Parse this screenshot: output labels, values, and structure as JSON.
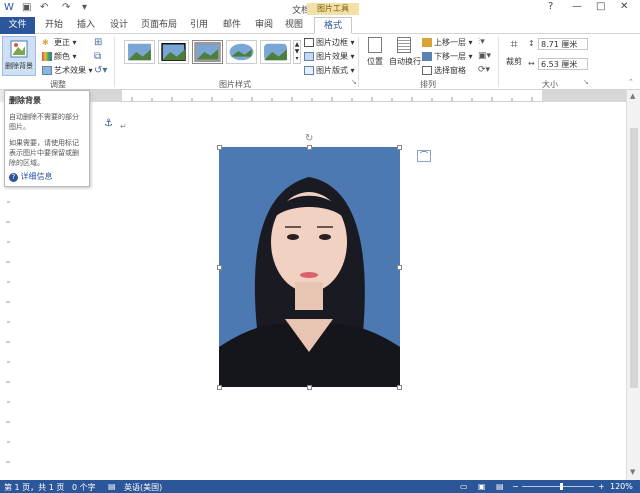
{
  "titlebar": {
    "title": "文档1 - Word",
    "help": "?",
    "minimize": "—",
    "restore": "□",
    "close": "✕"
  },
  "tabs": {
    "file": "文件",
    "items": [
      "开始",
      "插入",
      "设计",
      "页面布局",
      "引用",
      "邮件",
      "审阅",
      "视图"
    ],
    "context_group": "图片工具",
    "format": "格式"
  },
  "ribbon": {
    "adjust": {
      "remove_bg": "删除背景",
      "corrections": "更正",
      "color": "颜色",
      "artistic": "艺术效果",
      "label": "调整"
    },
    "picture_styles": {
      "border": "图片边框",
      "effects": "图片效果",
      "layout": "图片版式",
      "label": "图片样式"
    },
    "arrange": {
      "position": "位置",
      "wrap": "自动换行",
      "bring_forward": "上移一层",
      "send_backward": "下移一层",
      "selection_pane": "选择窗格",
      "label": "排列"
    },
    "size": {
      "crop": "裁剪",
      "height": "8.71 厘米",
      "width": "6.53 厘米",
      "label": "大小"
    }
  },
  "tooltip": {
    "title": "删除背景",
    "desc1": "自动删除不需要的部分图片。",
    "desc2": "如果需要，请使用标记表示图片中要保留或删除的区域。",
    "link": "详细信息"
  },
  "statusbar": {
    "page": "第 1 页，共 1 页",
    "words": "0 个字",
    "language": "英语(美国)",
    "zoom": "120%"
  },
  "colors": {
    "accent": "#2b579a",
    "photo_bg": "#4d79b3",
    "context_tab": "#f3e0a8"
  }
}
